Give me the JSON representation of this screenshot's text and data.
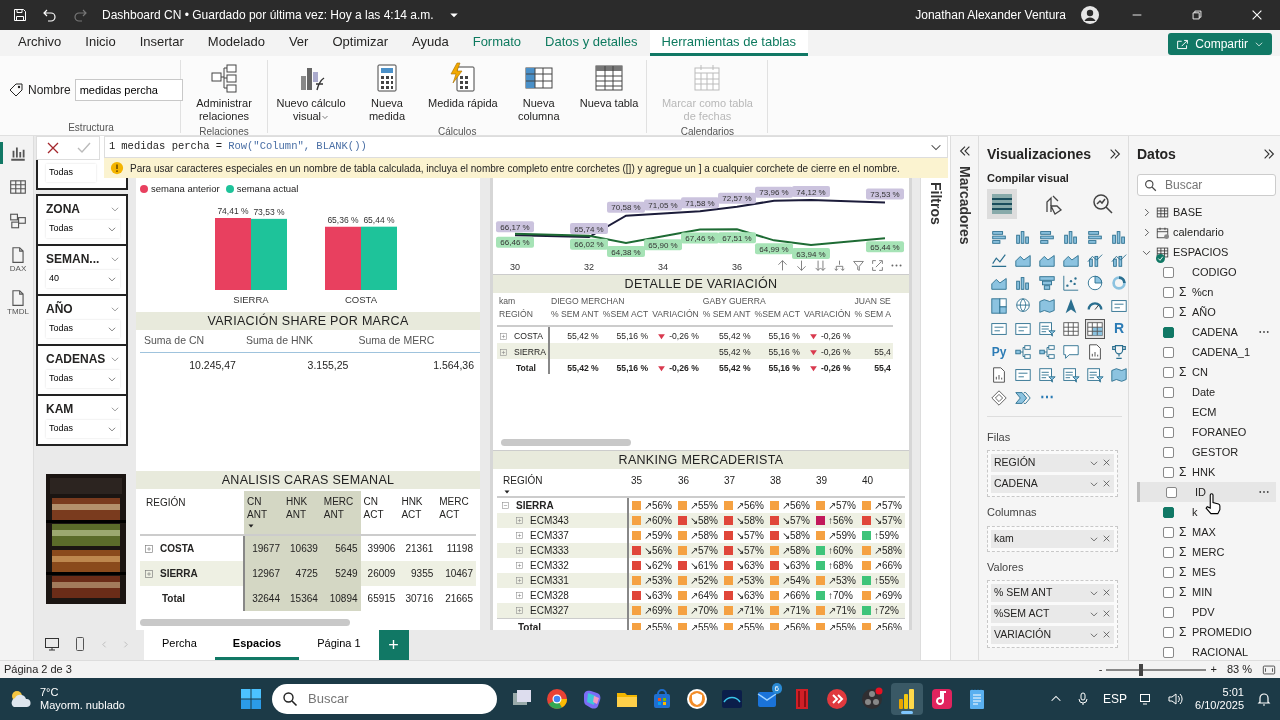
{
  "title_bar": {
    "title": "Dashboard CN • Guardado por última vez: Hoy a las 4:14 a.m.",
    "user": "Jonathan Alexander Ventura"
  },
  "menu": [
    {
      "label": "Archivo",
      "selected": false,
      "kind": "main"
    },
    {
      "label": "Inicio",
      "selected": false,
      "kind": "main"
    },
    {
      "label": "Insertar",
      "selected": false,
      "kind": "main"
    },
    {
      "label": "Modelado",
      "selected": false,
      "kind": "main"
    },
    {
      "label": "Ver",
      "selected": false,
      "kind": "main"
    },
    {
      "label": "Optimizar",
      "selected": false,
      "kind": "main"
    },
    {
      "label": "Ayuda",
      "selected": false,
      "kind": "main"
    },
    {
      "label": "Formato",
      "selected": false,
      "kind": "context"
    },
    {
      "label": "Datos y detalles",
      "selected": false,
      "kind": "context"
    },
    {
      "label": "Herramientas de tablas",
      "selected": true,
      "kind": "context"
    }
  ],
  "share_button": "Compartir",
  "ribbon": {
    "name_label": "Nombre",
    "name_value": "medidas percha",
    "groups": [
      {
        "label": "Estructura",
        "kind": "name"
      },
      {
        "label": "Relaciones",
        "kind": "buttons",
        "buttons": [
          {
            "label": "Administrar relaciones",
            "kind": "relations",
            "disabled": false,
            "dropdown": false
          }
        ]
      },
      {
        "label": "Cálculos",
        "kind": "buttons",
        "buttons": [
          {
            "label": "Nuevo cálculo visual",
            "kind": "visual-calc",
            "disabled": false,
            "dropdown": true
          },
          {
            "label": "Nueva medida",
            "kind": "calculator",
            "disabled": false,
            "dropdown": false
          },
          {
            "label": "Medida rápida",
            "kind": "quick",
            "disabled": false,
            "dropdown": false
          },
          {
            "label": "Nueva columna",
            "kind": "column",
            "disabled": false,
            "dropdown": false
          },
          {
            "label": "Nueva tabla",
            "kind": "table",
            "disabled": false,
            "dropdown": false
          }
        ]
      },
      {
        "label": "Calendarios",
        "kind": "buttons",
        "buttons": [
          {
            "label": "Marcar como tabla de fechas",
            "kind": "calendar",
            "disabled": true,
            "dropdown": false
          }
        ]
      }
    ]
  },
  "rail": [
    {
      "kind": "report",
      "selected": true
    },
    {
      "kind": "table",
      "selected": false
    },
    {
      "kind": "model",
      "selected": false
    },
    {
      "kind": "doc",
      "text": "DAX",
      "selected": false
    },
    {
      "kind": "doc",
      "text": "TMDL",
      "selected": false
    }
  ],
  "formula": {
    "line": "1",
    "parts": [
      {
        "text": "medidas percha =",
        "kind": "name"
      },
      {
        "text": "Row(\"Column\", BLANK())",
        "kind": "function"
      }
    ],
    "warning": "Para usar caracteres especiales en un nombre de tabla calculada, incluya el nombre completo entre corchetes ([]) y agregue un ] a cualquier corchete de cierre en el nombre."
  },
  "slicers": [
    {
      "value": "Todas"
    },
    {
      "title": "ZONA",
      "value": "Todas"
    },
    {
      "title": "SEMAN...",
      "value": "40"
    },
    {
      "title": "AÑO",
      "value": "Todas"
    },
    {
      "title": "CADENAS",
      "value": "Todas"
    },
    {
      "title": "KAM",
      "value": "Todas"
    }
  ],
  "bar_chart": {
    "chart_data": {
      "type": "bar",
      "categories": [
        "SIERRA",
        "COSTA"
      ],
      "series": [
        {
          "name": "semana anterior",
          "color": "#e8405f",
          "values": [
            74.41,
            65.36
          ],
          "value_labels": [
            "74,41 %",
            "65,36 %"
          ]
        },
        {
          "name": "semana actual",
          "color": "#1ec39a",
          "values": [
            73.53,
            65.44
          ],
          "value_labels": [
            "73,53 %",
            "65,44 %"
          ]
        }
      ]
    }
  },
  "share_table": {
    "title": "VARIACIÓN SHARE POR MARCA",
    "columns": [
      "Suma de CN",
      "Suma de HNK",
      "Suma de MERC"
    ],
    "values": [
      "10.245,47",
      "3.155,25",
      "1.564,36"
    ]
  },
  "caras_table": {
    "title": "ANALISIS CARAS SEMANAL",
    "row_header": "REGIÓN",
    "columns": [
      {
        "label": "CN ANT",
        "highlight": true,
        "sorted": true
      },
      {
        "label": "HNK ANT",
        "highlight": true,
        "sorted": false
      },
      {
        "label": "MERC ANT",
        "highlight": true,
        "sorted": false
      },
      {
        "label": "CN ACT",
        "highlight": false,
        "sorted": false
      },
      {
        "label": "HNK ACT",
        "highlight": false,
        "sorted": false
      },
      {
        "label": "MERC ACT",
        "highlight": false,
        "sorted": false
      }
    ],
    "rows": [
      {
        "label": "COSTA",
        "kind": "group",
        "expanded": false,
        "cells": [
          "19677",
          "10639",
          "5645",
          "39906",
          "21361",
          "11198"
        ]
      },
      {
        "label": "SIERRA",
        "kind": "group",
        "expanded": false,
        "cells": [
          "12967",
          "4725",
          "5249",
          "26009",
          "9355",
          "10467"
        ]
      },
      {
        "label": "Total",
        "kind": "total",
        "cells": [
          "32644",
          "15364",
          "10894",
          "65915",
          "30716",
          "21665"
        ]
      }
    ]
  },
  "line_chart": {
    "x_labels": [
      "30",
      "32",
      "34",
      "36"
    ],
    "series": [
      {
        "color": "#1c1c3a",
        "labels": [
          "66,17 %",
          "65,74 %",
          "70,58 %",
          "71,05 %",
          "71,58 %",
          "72,57 %",
          "73,96 %",
          "74,12 %",
          "73,53 %"
        ]
      },
      {
        "color": "#1e6b34",
        "labels": [
          "66,46 %",
          "66,02 %",
          "64,38 %",
          "65,90 %",
          "67,46 %",
          "67,51 %",
          "64,99 %",
          "63,94 %",
          "65,44 %"
        ]
      }
    ]
  },
  "detail_table": {
    "title": "DETALLE DE VARIACIÓN",
    "row_header": "kam",
    "col_header": "REGIÓN",
    "kams": [
      {
        "name": "DIEGO MERCHAN",
        "measures": [
          "% SEM ANT",
          "%SEM ACT",
          "VARIACIÓN"
        ]
      },
      {
        "name": "GABY GUERRA",
        "measures": [
          "% SEM ANT",
          "%SEM ACT",
          "VARIACIÓN"
        ]
      },
      {
        "name": "JUAN SE",
        "measures": [
          "% SEM A"
        ]
      }
    ],
    "rows": [
      {
        "label": "COSTA",
        "kind": "group",
        "expanded": false,
        "cells": [
          {
            "text": "55,42 %",
            "kind": "value"
          },
          {
            "text": "55,16 %",
            "kind": "value"
          },
          {
            "text": "-0,26 %",
            "kind": "down"
          },
          {
            "text": "55,42 %",
            "kind": "value"
          },
          {
            "text": "55,16 %",
            "kind": "value"
          },
          {
            "text": "-0,26 %",
            "kind": "down"
          },
          null
        ]
      },
      {
        "label": "SIERRA",
        "kind": "group",
        "expanded": false,
        "cells": [
          null,
          null,
          null,
          {
            "text": "55,42 %",
            "kind": "value"
          },
          {
            "text": "55,16 %",
            "kind": "value"
          },
          {
            "text": "-0,26 %",
            "kind": "down"
          },
          {
            "text": "55,4",
            "kind": "value"
          }
        ]
      },
      {
        "label": "Total",
        "kind": "total",
        "cells": [
          {
            "text": "55,42 %",
            "kind": "value"
          },
          {
            "text": "55,16 %",
            "kind": "value"
          },
          {
            "text": "-0,26 %",
            "kind": "down"
          },
          {
            "text": "55,42 %",
            "kind": "value"
          },
          {
            "text": "55,16 %",
            "kind": "value"
          },
          {
            "text": "-0,26 %",
            "kind": "down"
          },
          {
            "text": "55,4",
            "kind": "value"
          }
        ]
      }
    ]
  },
  "ranking": {
    "title": "RANKING MERCADERISTA",
    "row_header": "REGIÓN",
    "sorted": true,
    "columns": [
      "35",
      "36",
      "37",
      "38",
      "39",
      "40"
    ],
    "rows": [
      {
        "label": "SIERRA",
        "expanded": true,
        "cells": [
          {
            "text": "↗56%",
            "color": "#f5a142"
          },
          {
            "text": "↗55%",
            "color": "#f5a142"
          },
          {
            "text": "↗56%",
            "color": "#f5a142"
          },
          {
            "text": "↗56%",
            "color": "#f5a142"
          },
          {
            "text": "↗57%",
            "color": "#f5a142"
          },
          {
            "text": "↗57%",
            "color": "#f5a142"
          }
        ],
        "children": [
          {
            "label": "ECM343",
            "expanded": false,
            "cells": [
              {
                "text": "↗60%",
                "color": "#f5a142"
              },
              {
                "text": "↘58%",
                "color": "#e0463a"
              },
              {
                "text": "↘58%",
                "color": "#e0463a"
              },
              {
                "text": "↘57%",
                "color": "#e0463a"
              },
              {
                "text": "↑56%",
                "color": "#c2185b"
              },
              {
                "text": "↘57%",
                "color": "#e0463a"
              }
            ]
          },
          {
            "label": "ECM337",
            "expanded": false,
            "cells": [
              {
                "text": "↗59%",
                "color": "#f5a142"
              },
              {
                "text": "↗58%",
                "color": "#f5a142"
              },
              {
                "text": "↘57%",
                "color": "#e0463a"
              },
              {
                "text": "↘58%",
                "color": "#e0463a"
              },
              {
                "text": "↗59%",
                "color": "#f5a142"
              },
              {
                "text": "↑59%",
                "color": "#3ec47a"
              }
            ]
          },
          {
            "label": "ECM333",
            "expanded": false,
            "cells": [
              {
                "text": "↘56%",
                "color": "#e0463a"
              },
              {
                "text": "↗57%",
                "color": "#f5a142"
              },
              {
                "text": "↘57%",
                "color": "#e0463a"
              },
              {
                "text": "↗58%",
                "color": "#f5a142"
              },
              {
                "text": "↑60%",
                "color": "#3ec47a"
              },
              {
                "text": "↗58%",
                "color": "#f5a142"
              }
            ]
          },
          {
            "label": "ECM332",
            "expanded": false,
            "cells": [
              {
                "text": "↘62%",
                "color": "#e0463a"
              },
              {
                "text": "↘61%",
                "color": "#e0463a"
              },
              {
                "text": "↘63%",
                "color": "#e0463a"
              },
              {
                "text": "↘63%",
                "color": "#e0463a"
              },
              {
                "text": "↑68%",
                "color": "#3ec47a"
              },
              {
                "text": "↗66%",
                "color": "#f5a142"
              }
            ]
          },
          {
            "label": "ECM331",
            "expanded": false,
            "cells": [
              {
                "text": "↗53%",
                "color": "#f5a142"
              },
              {
                "text": "↗52%",
                "color": "#f5a142"
              },
              {
                "text": "↗53%",
                "color": "#f5a142"
              },
              {
                "text": "↗54%",
                "color": "#f5a142"
              },
              {
                "text": "↗53%",
                "color": "#f5a142"
              },
              {
                "text": "↑55%",
                "color": "#3ec47a"
              }
            ]
          },
          {
            "label": "ECM328",
            "expanded": false,
            "cells": [
              {
                "text": "↘63%",
                "color": "#e0463a"
              },
              {
                "text": "↗64%",
                "color": "#f5a142"
              },
              {
                "text": "↘63%",
                "color": "#e0463a"
              },
              {
                "text": "↗66%",
                "color": "#f5a142"
              },
              {
                "text": "↑70%",
                "color": "#3ec47a"
              },
              {
                "text": "↗69%",
                "color": "#f5a142"
              }
            ]
          },
          {
            "label": "ECM327",
            "expanded": false,
            "cells": [
              {
                "text": "↗69%",
                "color": "#f5a142"
              },
              {
                "text": "↗70%",
                "color": "#f5a142"
              },
              {
                "text": "↗71%",
                "color": "#f5a142"
              },
              {
                "text": "↗71%",
                "color": "#f5a142"
              },
              {
                "text": "↗71%",
                "color": "#f5a142"
              },
              {
                "text": "↑72%",
                "color": "#3ec47a"
              }
            ]
          }
        ]
      }
    ],
    "total": {
      "label": "Total",
      "cells": [
        {
          "text": "↗55%",
          "color": "#f5a142"
        },
        {
          "text": "↗55%",
          "color": "#f5a142"
        },
        {
          "text": "↗55%",
          "color": "#f5a142"
        },
        {
          "text": "↗56%",
          "color": "#f5a142"
        },
        {
          "text": "↗55%",
          "color": "#f5a142"
        },
        {
          "text": "↗56%",
          "color": "#f5a142"
        }
      ]
    }
  },
  "filters_label": "Filtros",
  "bookmarks_label": "Marcadores",
  "visualizations": {
    "title": "Visualizaciones",
    "subtitle": "Compilar visual",
    "build_tabs": [
      {
        "kind": "fields",
        "selected": true
      },
      {
        "kind": "format",
        "selected": false
      },
      {
        "kind": "analytics",
        "selected": false
      }
    ],
    "types": [
      {
        "kind": "bar-h",
        "selected": false
      },
      {
        "kind": "bar-v",
        "selected": false
      },
      {
        "kind": "bar-h",
        "selected": false
      },
      {
        "kind": "bar-v",
        "selected": false
      },
      {
        "kind": "bar-h",
        "selected": false
      },
      {
        "kind": "bar-v",
        "selected": false
      },
      {
        "kind": "line",
        "selected": false
      },
      {
        "kind": "area",
        "selected": false
      },
      {
        "kind": "area",
        "selected": false
      },
      {
        "kind": "area",
        "selected": false
      },
      {
        "kind": "combo",
        "selected": false
      },
      {
        "kind": "combo",
        "selected": false
      },
      {
        "kind": "area",
        "selected": false
      },
      {
        "kind": "bar-v",
        "selected": false
      },
      {
        "kind": "funnel",
        "selected": false
      },
      {
        "kind": "scatter",
        "selected": false
      },
      {
        "kind": "pie",
        "selected": false
      },
      {
        "kind": "donut",
        "selected": false
      },
      {
        "kind": "treemap",
        "selected": false
      },
      {
        "kind": "globe",
        "selected": false
      },
      {
        "kind": "map",
        "selected": false
      },
      {
        "kind": "arrow",
        "selected": false
      },
      {
        "kind": "gauge",
        "selected": false
      },
      {
        "kind": "card",
        "selected": false
      },
      {
        "kind": "card",
        "selected": false
      },
      {
        "kind": "card",
        "selected": false
      },
      {
        "kind": "slicer",
        "selected": false
      },
      {
        "kind": "table",
        "selected": false
      },
      {
        "kind": "matrix",
        "selected": true
      },
      {
        "kind": "text",
        "text": "R",
        "selected": false
      },
      {
        "kind": "text",
        "text": "Py",
        "selected": false
      },
      {
        "kind": "tree",
        "selected": false
      },
      {
        "kind": "tree",
        "selected": false
      },
      {
        "kind": "speech",
        "selected": false
      },
      {
        "kind": "doc",
        "selected": false
      },
      {
        "kind": "trophy",
        "selected": false
      },
      {
        "kind": "doc",
        "selected": false
      },
      {
        "kind": "card",
        "selected": false
      },
      {
        "kind": "slicer",
        "selected": false
      },
      {
        "kind": "slicer",
        "selected": false
      },
      {
        "kind": "slicer",
        "selected": false
      },
      {
        "kind": "map",
        "selected": false
      },
      {
        "kind": "diamond",
        "selected": false
      },
      {
        "kind": "chevrons",
        "selected": false
      },
      {
        "kind": "text",
        "text": "⋯",
        "selected": false
      }
    ],
    "sections": [
      {
        "label": "Filas",
        "fields": [
          "REGIÓN",
          "CADENA"
        ]
      },
      {
        "label": "Columnas",
        "fields": [
          "kam"
        ]
      },
      {
        "label": "Valores",
        "fields": [
          "% SEM ANT",
          "%SEM ACT",
          "VARIACIÓN"
        ]
      }
    ]
  },
  "data_pane": {
    "title": "Datos",
    "placeholder": "Buscar",
    "tables": [
      {
        "label": "BASE",
        "expanded": false,
        "kind": "table"
      },
      {
        "label": "calendario",
        "expanded": false,
        "kind": "calendar"
      },
      {
        "label": "ESPACIOS",
        "expanded": true,
        "kind": "table-used",
        "children": [
          {
            "label": "CODIGO",
            "checked": false,
            "hovered": false,
            "more_button": false
          },
          {
            "label": "%cn",
            "prefix": "Σ",
            "checked": false,
            "hovered": false,
            "more_button": false
          },
          {
            "label": "AÑO",
            "prefix": "Σ",
            "checked": false,
            "hovered": false,
            "more_button": false
          },
          {
            "label": "CADENA",
            "checked": true,
            "hovered": false,
            "more_button": true
          },
          {
            "label": "CADENA_1",
            "checked": false,
            "hovered": false,
            "more_button": false
          },
          {
            "label": "CN",
            "prefix": "Σ",
            "checked": false,
            "hovered": false,
            "more_button": false
          },
          {
            "label": "Date",
            "checked": false,
            "hovered": false,
            "more_button": false
          },
          {
            "label": "ECM",
            "checked": false,
            "hovered": false,
            "more_button": false
          },
          {
            "label": "FORANEO",
            "checked": false,
            "hovered": false,
            "more_button": false
          },
          {
            "label": "GESTOR",
            "checked": false,
            "hovered": false,
            "more_button": false
          },
          {
            "label": "HNK",
            "prefix": "Σ",
            "checked": false,
            "hovered": false,
            "more_button": false
          },
          {
            "label": "ID",
            "checked": false,
            "hovered": true,
            "more_button": true
          },
          {
            "label": "k",
            "checked": true,
            "hovered": false,
            "more_button": false
          },
          {
            "label": "MAX",
            "prefix": "Σ",
            "checked": false,
            "hovered": false,
            "more_button": false
          },
          {
            "label": "MERC",
            "prefix": "Σ",
            "checked": false,
            "hovered": false,
            "more_button": false
          },
          {
            "label": "MES",
            "prefix": "Σ",
            "checked": false,
            "hovered": false,
            "more_button": false
          },
          {
            "label": "MIN",
            "prefix": "Σ",
            "checked": false,
            "hovered": false,
            "more_button": false
          },
          {
            "label": "PDV",
            "checked": false,
            "hovered": false,
            "more_button": false
          },
          {
            "label": "PROMEDIO",
            "prefix": "Σ",
            "checked": false,
            "hovered": false,
            "more_button": false
          },
          {
            "label": "RACIONAL",
            "checked": false,
            "hovered": false,
            "more_button": false
          }
        ]
      }
    ]
  },
  "page_tabs": [
    {
      "label": "Percha",
      "selected": false
    },
    {
      "label": "Espacios",
      "selected": true
    },
    {
      "label": "Página 1",
      "selected": false
    }
  ],
  "add_page": "+",
  "status_bar": {
    "page": "Página 2 de 3",
    "zoom_out": "-",
    "zoom_in": "+",
    "zoom": {
      "level": 0.35,
      "text": "83 %"
    }
  },
  "taskbar": {
    "temperature": "7°C",
    "weather": "Mayorm. nublado",
    "search_placeholder": "Buscar",
    "apps": [
      {
        "kind": "task-view",
        "selected": false
      },
      {
        "kind": "browser",
        "selected": false
      },
      {
        "kind": "assistant",
        "selected": false
      },
      {
        "kind": "folder",
        "selected": false
      },
      {
        "kind": "store",
        "selected": false
      },
      {
        "kind": "vpn",
        "selected": false
      },
      {
        "kind": "video",
        "selected": false
      },
      {
        "kind": "mail",
        "badge": "6",
        "selected": false
      },
      {
        "kind": "red",
        "selected": false
      },
      {
        "kind": "remote",
        "selected": false
      },
      {
        "kind": "recorder",
        "selected": false
      },
      {
        "kind": "powerbi",
        "selected": true
      },
      {
        "kind": "music",
        "selected": false
      },
      {
        "kind": "notepad",
        "selected": false
      }
    ],
    "language": "ESP",
    "time": "5:01",
    "date": "6/10/2025"
  }
}
